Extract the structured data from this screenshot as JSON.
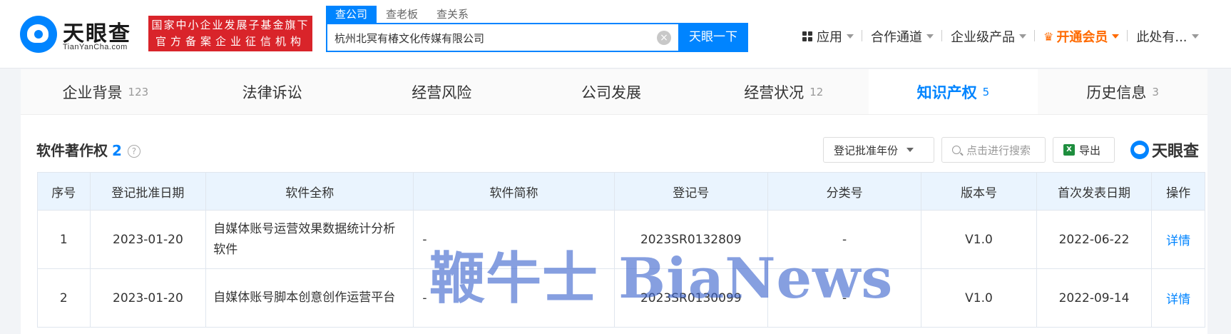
{
  "brand": {
    "name": "天眼查",
    "pinyin": "TianYanCha.com"
  },
  "badge": {
    "line1": "国家中小企业发展子基金旗下",
    "line2": "官方备案企业征信机构"
  },
  "search": {
    "tabs": [
      "查公司",
      "查老板",
      "查关系"
    ],
    "query": "杭州北冥有椿文化传媒有限公司",
    "button": "天眼一下"
  },
  "topnav": {
    "apps": "应用",
    "channel": "合作通道",
    "enterprise": "企业级产品",
    "vip": "开通会员",
    "user": "此处有..."
  },
  "section_tabs": [
    {
      "label": "企业背景",
      "count": "123"
    },
    {
      "label": "法律诉讼",
      "count": ""
    },
    {
      "label": "经营风险",
      "count": ""
    },
    {
      "label": "公司发展",
      "count": ""
    },
    {
      "label": "经营状况",
      "count": "12"
    },
    {
      "label": "知识产权",
      "count": "5"
    },
    {
      "label": "历史信息",
      "count": "3"
    }
  ],
  "panel": {
    "title": "软件著作权",
    "count": "2",
    "filter": "登记批准年份",
    "search_placeholder": "点击进行搜索",
    "export": "导出",
    "watermark_logo": "天眼查"
  },
  "table": {
    "headers": [
      "序号",
      "登记批准日期",
      "软件全称",
      "软件简称",
      "登记号",
      "分类号",
      "版本号",
      "首次发表日期",
      "操作"
    ],
    "rows": [
      {
        "no": "1",
        "date": "2023-01-20",
        "name": "自媒体账号运营效果数据统计分析软件",
        "abbr": "-",
        "reg": "2023SR0132809",
        "cls": "-",
        "ver": "V1.0",
        "pub": "2022-06-22",
        "op": "详情"
      },
      {
        "no": "2",
        "date": "2023-01-20",
        "name": "自媒体账号脚本创意创作运营平台",
        "abbr": "-",
        "reg": "2023SR0130099",
        "cls": "-",
        "ver": "V1.0",
        "pub": "2022-09-14",
        "op": "详情"
      }
    ]
  },
  "overlay_watermark": "鞭牛士 BiaNews",
  "colors": {
    "primary": "#0084ff",
    "badge": "#d9242a",
    "vip": "#ff6a00"
  }
}
